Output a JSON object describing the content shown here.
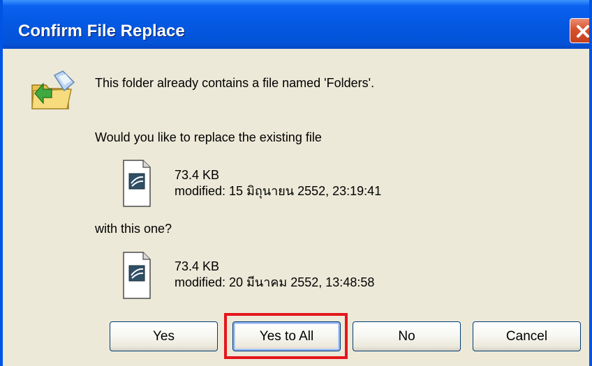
{
  "window": {
    "title": "Confirm File Replace"
  },
  "message": {
    "line1": "This folder already contains a file named 'Folders'.",
    "line2": "Would you like to replace the existing file",
    "line3": "with this one?"
  },
  "existing_file": {
    "size": "73.4 KB",
    "modified": "modified: 15 มิถุนายน 2552, 23:19:41",
    "icon": "file-icon"
  },
  "new_file": {
    "size": "73.4 KB",
    "modified": "modified: 20 มีนาคม 2552, 13:48:58",
    "icon": "file-icon"
  },
  "buttons": {
    "yes": "Yes",
    "yes_to_all": "Yes to All",
    "no": "No",
    "cancel": "Cancel"
  },
  "colors": {
    "titlebar": "#0458e2",
    "close_button": "#d8512d",
    "dialog_background": "#ece9d8",
    "highlight_box": "#e4161c"
  }
}
